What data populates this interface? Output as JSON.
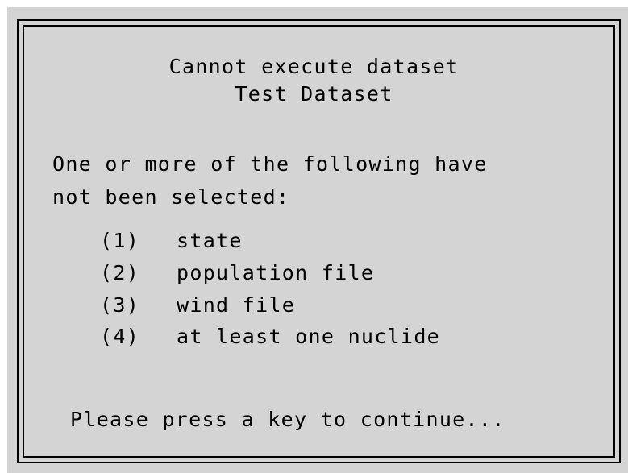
{
  "dialog": {
    "title_line1": "Cannot execute dataset",
    "title_line2": "Test Dataset",
    "message_line1": "One or more of the following have",
    "message_line2": "not been selected:",
    "items": [
      {
        "number": "(1)",
        "label": "state"
      },
      {
        "number": "(2)",
        "label": "population file"
      },
      {
        "number": "(3)",
        "label": "wind file"
      },
      {
        "number": "(4)",
        "label": "at least one nuclide"
      }
    ],
    "prompt": "Please press a key to continue..."
  }
}
